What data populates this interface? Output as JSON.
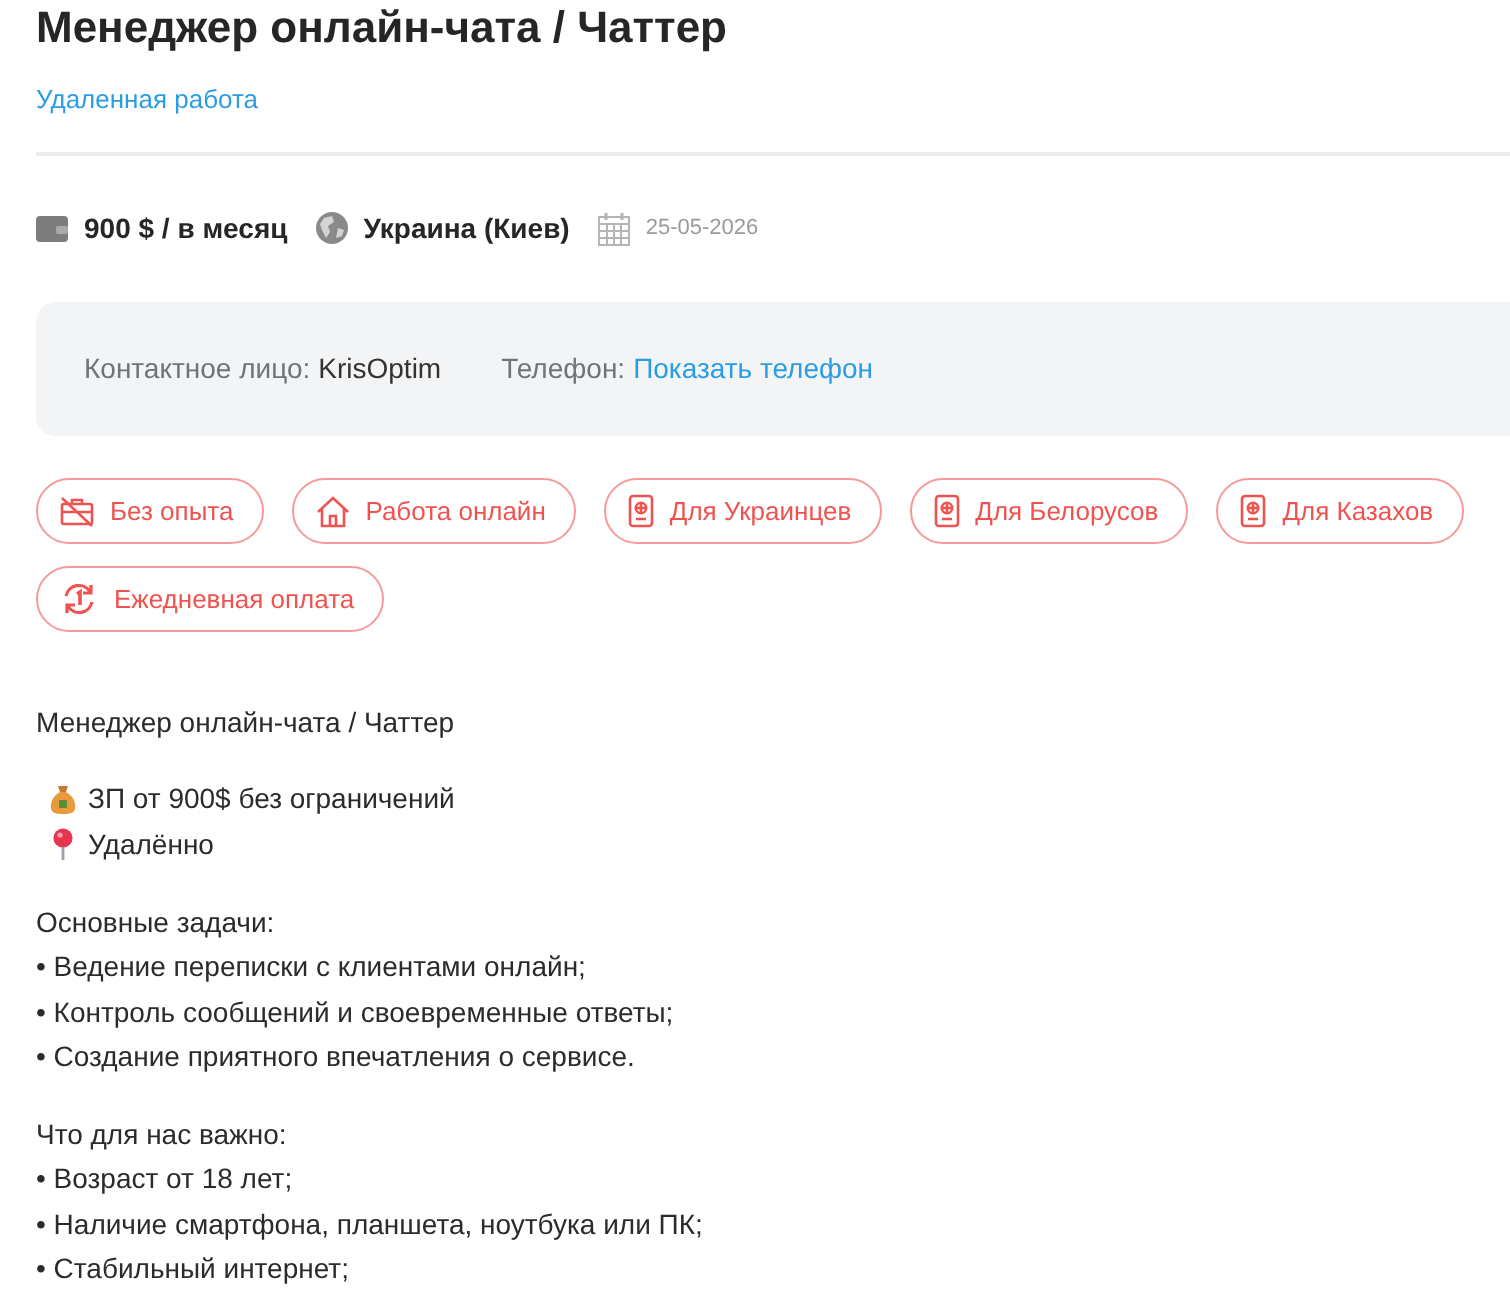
{
  "title": "Менеджер онлайн-чата / Чаттер",
  "category_link": "Удаленная работа",
  "meta": {
    "salary": "900 $ / в месяц",
    "location": "Украина (Киев)",
    "date": "25-05-2026"
  },
  "contact": {
    "label": "Контактное лицо:",
    "name": "KrisOptim",
    "phone_label": "Телефон:",
    "phone_link": "Показать телефон"
  },
  "tags": [
    {
      "kind": "no-experience",
      "label": "Без опыта"
    },
    {
      "kind": "home",
      "label": "Работа онлайн"
    },
    {
      "kind": "passport",
      "label": "Для Украинцев"
    },
    {
      "kind": "passport",
      "label": "Для Белорусов"
    },
    {
      "kind": "passport",
      "label": "Для Казахов"
    },
    {
      "kind": "daily",
      "label": "Ежедневная оплата"
    }
  ],
  "description": [
    {
      "lines": [
        {
          "kind": "text",
          "text": "Менеджер онлайн-чата / Чаттер"
        }
      ]
    },
    {
      "lines": [
        {
          "kind": "money",
          "text": "ЗП от 900$ без ограничений"
        },
        {
          "kind": "location",
          "text": "Удалённо"
        }
      ]
    },
    {
      "lines": [
        {
          "kind": "text",
          "text": "Основные задачи:"
        },
        {
          "kind": "text",
          "text": "• Ведение переписки с клиентами онлайн;"
        },
        {
          "kind": "text",
          "text": "• Контроль сообщений и своевременные ответы;"
        },
        {
          "kind": "text",
          "text": "• Создание приятного впечатления о сервисе."
        }
      ]
    },
    {
      "lines": [
        {
          "kind": "text",
          "text": "Что для нас важно:"
        },
        {
          "kind": "text",
          "text": "• Возраст от 18 лет;"
        },
        {
          "kind": "text",
          "text": "• Наличие смартфона, планшета, ноутбука или ПК;"
        },
        {
          "kind": "text",
          "text": "• Стабильный интернет;"
        }
      ]
    }
  ]
}
